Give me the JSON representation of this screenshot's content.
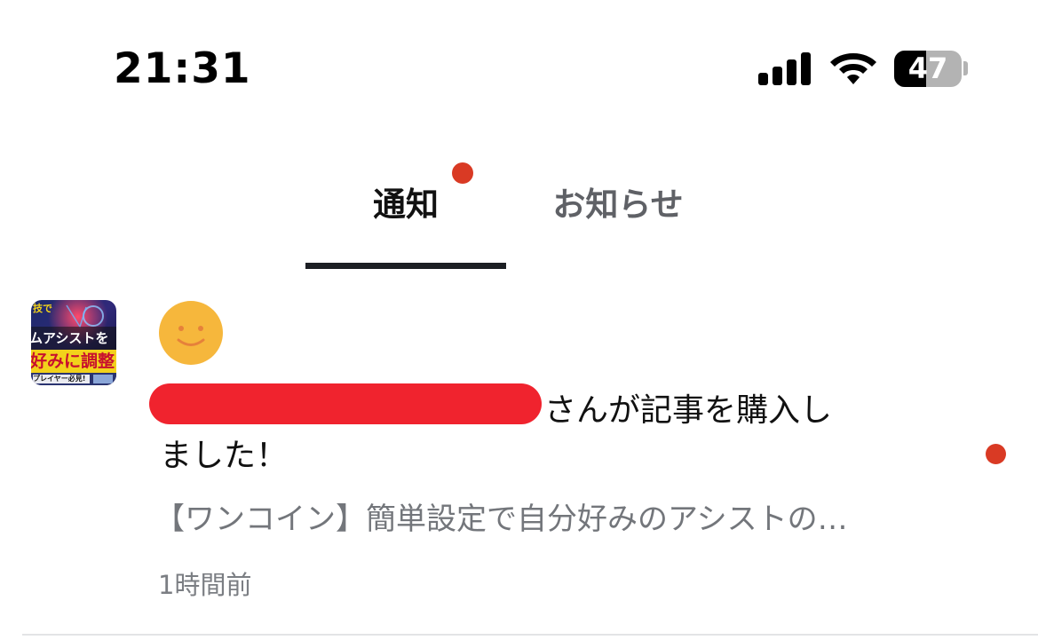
{
  "status_bar": {
    "time": "21:31",
    "battery_percent": "47",
    "battery_level": 0.47
  },
  "tabs": [
    {
      "label": "通知",
      "active": true,
      "has_badge": true
    },
    {
      "label": "お知らせ",
      "active": false,
      "has_badge": false
    }
  ],
  "notification": {
    "message_line1": "さんが記事を購入し",
    "message_line2": "ました！",
    "article_title": "【ワンコイン】簡単設定で自分好みのアシストの…",
    "timestamp": "1時間前",
    "unread": true,
    "thumbnail_text": {
      "line1": "ムアシストを",
      "line2": "好みに調整",
      "line3": "プレイヤー必見!",
      "tag": "技で"
    }
  },
  "colors": {
    "badge": "#d93a24",
    "redaction": "#f0232e",
    "avatar": "#f6b73c",
    "active_tab_text": "#111111",
    "inactive_tab_text": "#5f6166",
    "secondary_text": "#73767b"
  }
}
